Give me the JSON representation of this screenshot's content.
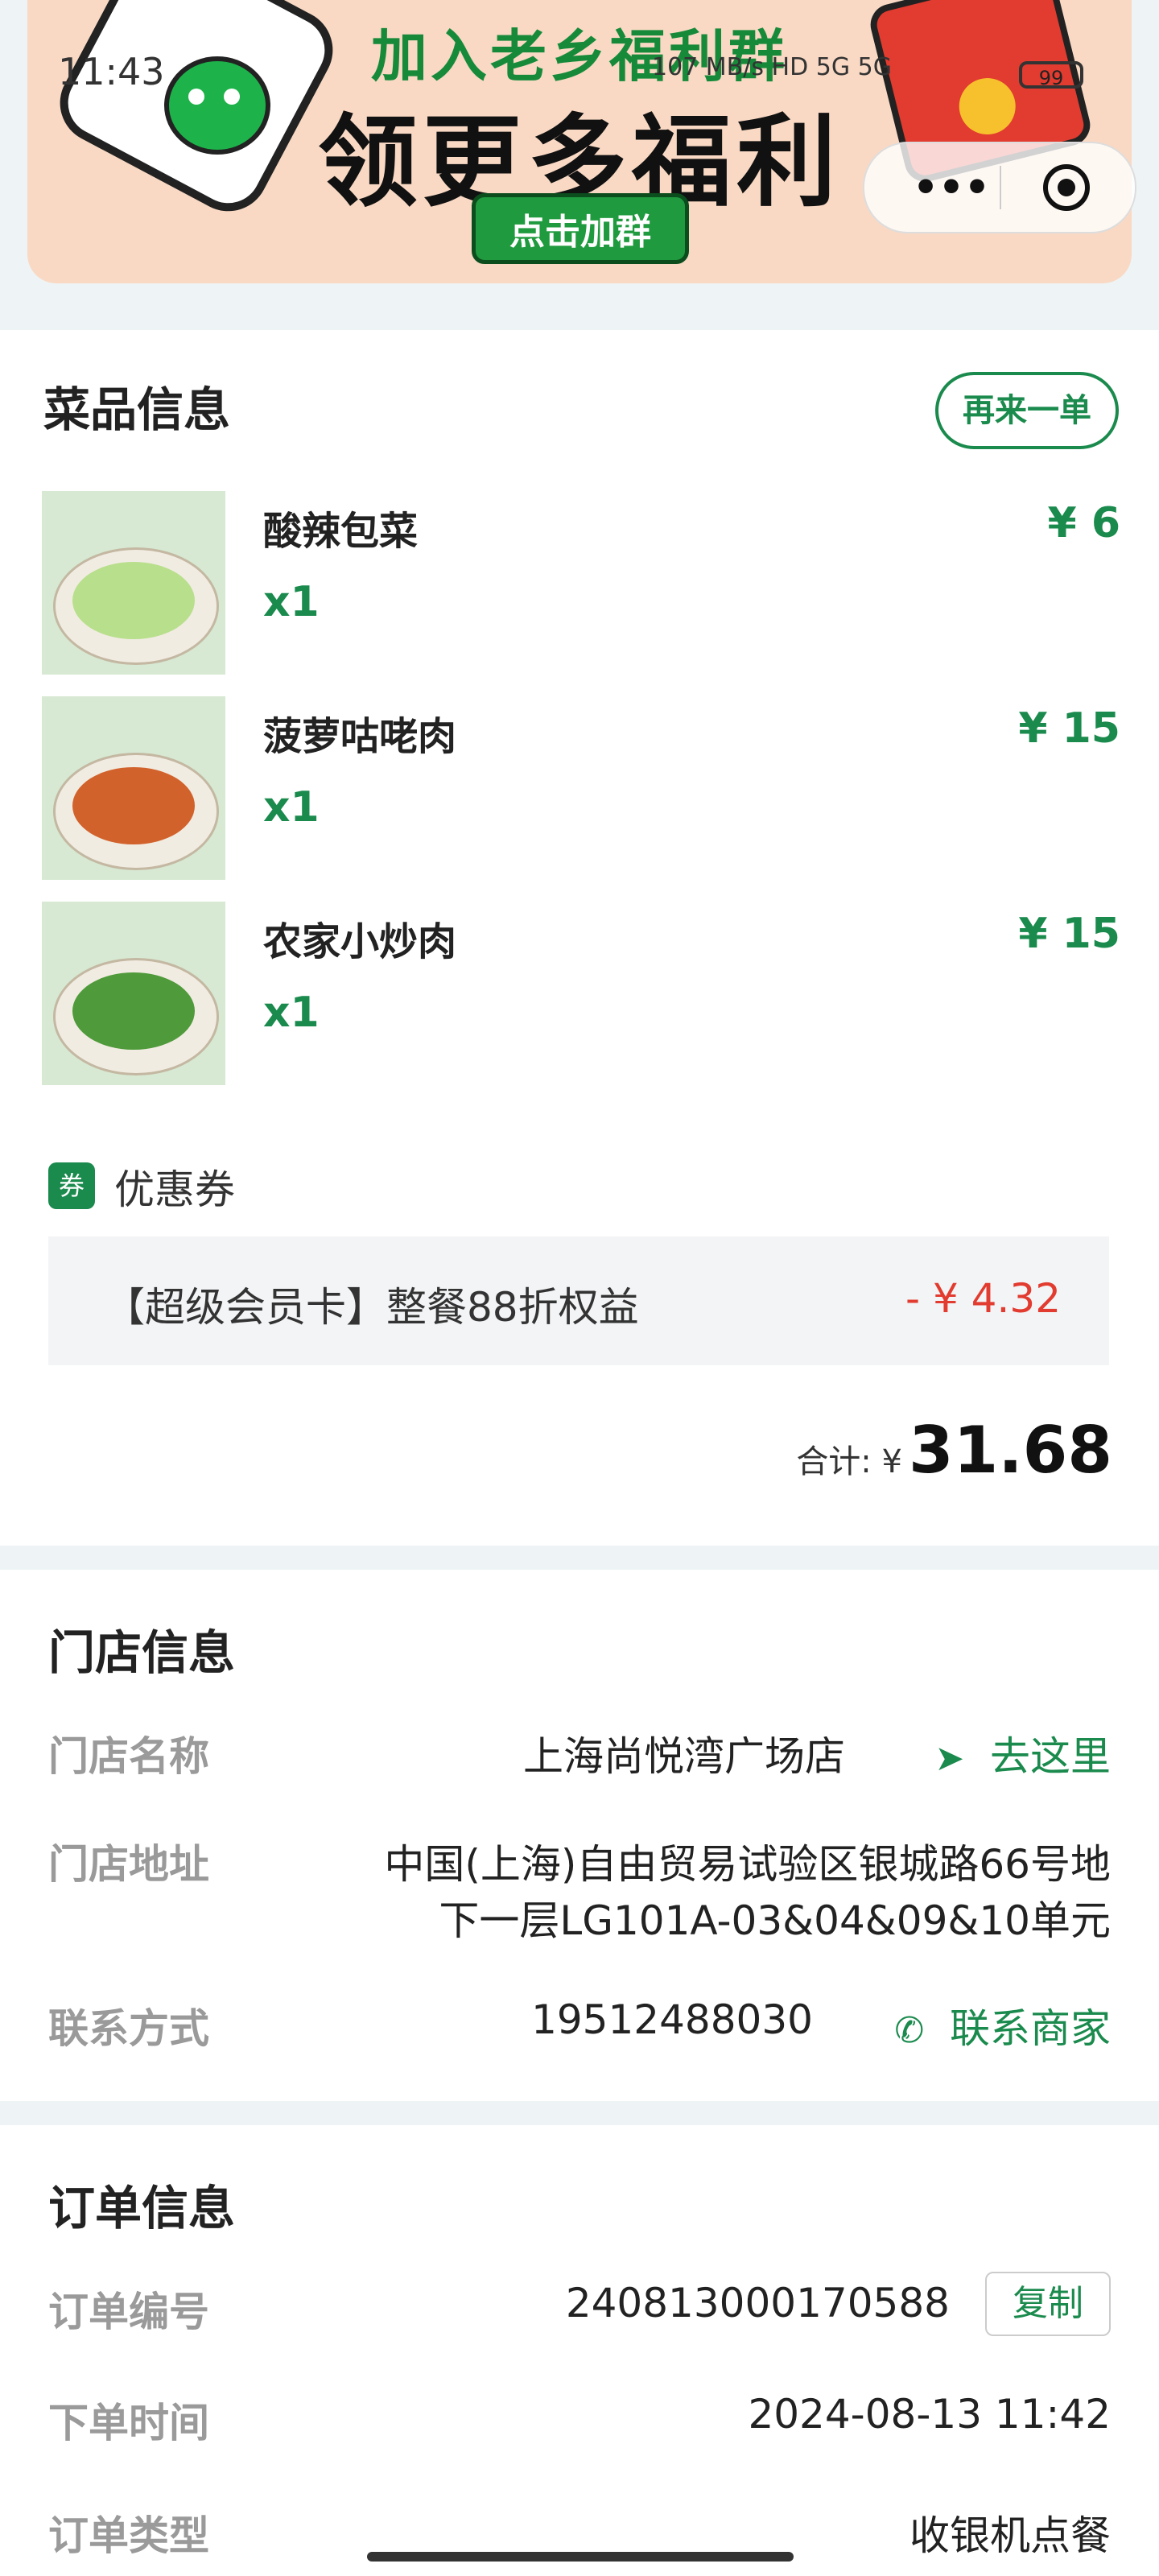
{
  "status_bar": {
    "time": "11:43",
    "net": "107 MB/s",
    "network": "HD 5G 5G",
    "battery": "99"
  },
  "banner": {
    "line1": "加入老乡福利群",
    "line2": "领更多福利",
    "button": "点击加群"
  },
  "capsule": {
    "more": "•••"
  },
  "items_section": {
    "title": "菜品信息",
    "reorder": "再来一单",
    "dishes": [
      {
        "name": "酸辣包菜",
        "qty": "x1",
        "price": "¥ 6",
        "food_color": "#b8df8c"
      },
      {
        "name": "菠萝咕咾肉",
        "qty": "x1",
        "price": "¥ 15",
        "food_color": "#d2622b"
      },
      {
        "name": "农家小炒肉",
        "qty": "x1",
        "price": "¥ 15",
        "food_color": "#4f9a3a"
      }
    ],
    "coupon": {
      "badge": "券",
      "label": "优惠券",
      "name": "【超级会员卡】整餐88折权益",
      "amount": "- ¥ 4.32"
    },
    "total_label": "合计: ¥",
    "total_value": "31.68"
  },
  "store_section": {
    "title": "门店信息",
    "name_label": "门店名称",
    "name_value": "上海尚悦湾广场店",
    "navigate": "去这里",
    "address_label": "门店地址",
    "address_line1": "中国(上海)自由贸易试验区银城路66号地",
    "address_line2": "下一层LG101A-03&04&09&10单元",
    "contact_label": "联系方式",
    "contact_value": "19512488030",
    "contact_action": "联系商家"
  },
  "order_section": {
    "title": "订单信息",
    "number_label": "订单编号",
    "number_value": "240813000170588",
    "copy": "复制",
    "time_label": "下单时间",
    "time_value": "2024-08-13 11:42",
    "type_label": "订单类型",
    "type_value": "收银机点餐"
  },
  "colors": {
    "accent": "#1a8a4d",
    "discount": "#e23b2f"
  }
}
